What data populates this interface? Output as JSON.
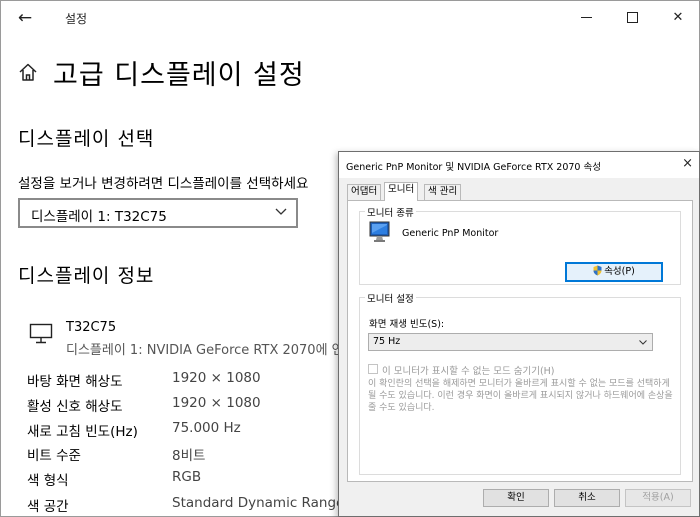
{
  "window": {
    "back_label": "←",
    "app_title": "설정",
    "minimize_label": "",
    "maximize_label": "",
    "close_label": "✕"
  },
  "page": {
    "title": "고급 디스플레이 설정"
  },
  "select_display": {
    "heading": "디스플레이 선택",
    "description": "설정을 보거나 변경하려면 디스플레이를 선택하세요",
    "selected": "디스플레이 1: T32C75"
  },
  "display_info": {
    "heading": "디스플레이 정보",
    "monitor_name": "T32C75",
    "monitor_sub": "디스플레이 1: NVIDIA GeForce RTX 2070에 연",
    "rows": [
      {
        "label": "바탕 화면 해상도",
        "value": "1920 × 1080"
      },
      {
        "label": "활성 신호 해상도",
        "value": "1920 × 1080"
      },
      {
        "label": "새로 고침 빈도(Hz)",
        "value": "75.000 Hz"
      },
      {
        "label": "비트 수준",
        "value": "8비트"
      },
      {
        "label": "색 형식",
        "value": "RGB"
      },
      {
        "label": "색 공간",
        "value": "Standard Dynamic Range(S"
      }
    ]
  },
  "dialog": {
    "title": "Generic PnP Monitor 및 NVIDIA GeForce RTX 2070 속성",
    "close_label": "×",
    "tabs": [
      "어댑터",
      "모니터",
      "색 관리"
    ],
    "active_tab": "모니터",
    "monitor_type": {
      "legend": "모니터 종류",
      "name": "Generic PnP Monitor",
      "properties_button": "속성(P)"
    },
    "monitor_settings": {
      "legend": "모니터 설정",
      "refresh_label": "화면 재생 빈도(S):",
      "refresh_value": "75 Hz",
      "hide_modes_label": "이 모니터가 표시할 수 없는 모드 숨기기(H)",
      "hide_modes_checked": false,
      "warning": "이 확인란의 선택을 해제하면 모니터가 올바르게 표시할 수 없는 모드를 선택하게 될 수도 있습니다. 이런 경우 화면이 올바르게 표시되지 않거나 하드웨어에 손상을 줄 수도 있습니다."
    },
    "buttons": {
      "ok": "확인",
      "cancel": "취소",
      "apply": "적용(A)"
    }
  },
  "colors": {
    "accent": "#0078d7",
    "dialog_bg": "#f0f0f0",
    "disabled_text": "#9a9a9a"
  },
  "icons": {
    "back": "back-arrow-icon",
    "home": "home-icon",
    "monitor": "monitor-icon",
    "chevron": "chevron-down-icon",
    "shield": "shield-icon",
    "generic_monitor": "generic-monitor-icon"
  }
}
